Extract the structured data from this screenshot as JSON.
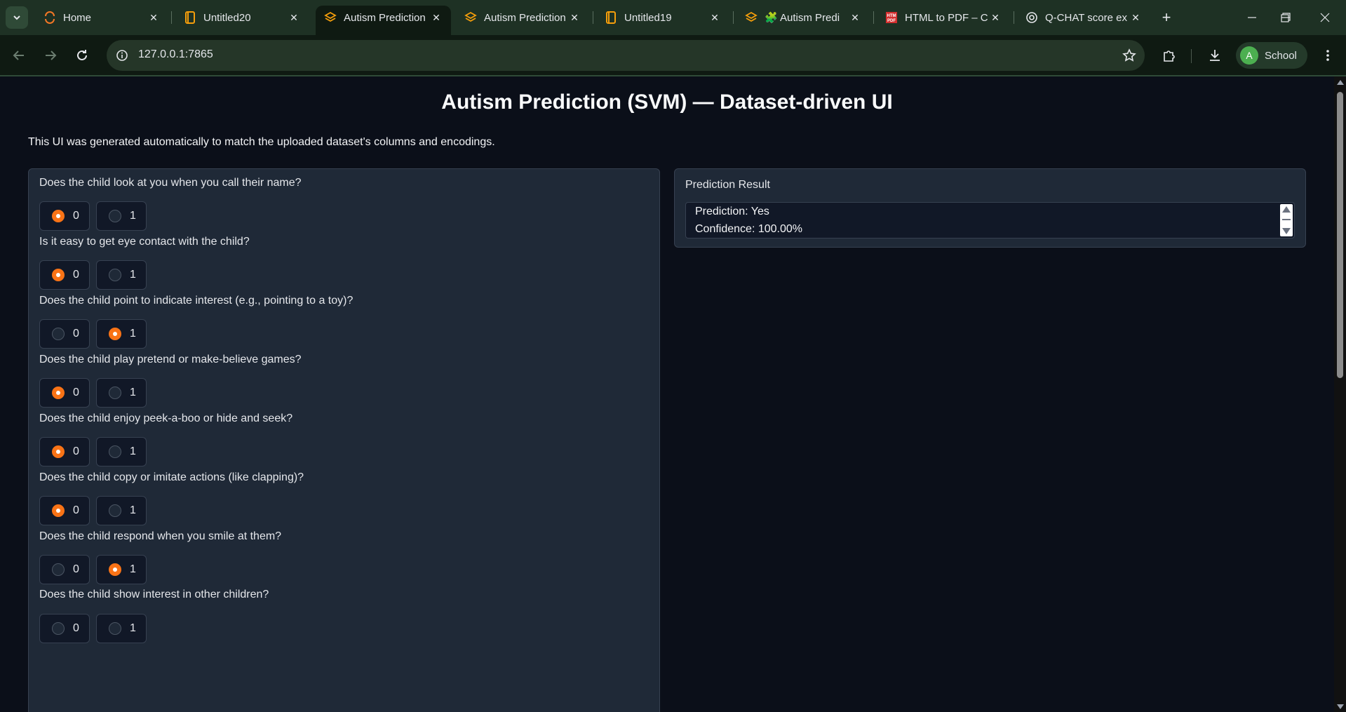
{
  "browser": {
    "tabs": [
      {
        "title": "Home",
        "icon": "jupyter-icon",
        "active": false
      },
      {
        "title": "Untitled20",
        "icon": "notebook-icon",
        "active": false
      },
      {
        "title": "Autism Prediction",
        "icon": "gradio-icon",
        "active": true
      },
      {
        "title": "Autism Prediction",
        "icon": "gradio-icon",
        "active": false
      },
      {
        "title": "Untitled19",
        "icon": "notebook-icon",
        "active": false
      },
      {
        "title": "🧩 Autism Predi",
        "icon": "gradio-icon",
        "active": false
      },
      {
        "title": "HTML to PDF – C",
        "icon": "pdf-icon",
        "active": false
      },
      {
        "title": "Q-CHAT score ex",
        "icon": "chatgpt-icon",
        "active": false
      }
    ],
    "url": "127.0.0.1:7865",
    "profile": {
      "initial": "A",
      "name": "School"
    }
  },
  "page": {
    "title": "Autism Prediction (SVM) — Dataset-driven UI",
    "description": "This UI was generated automatically to match the uploaded dataset's columns and encodings."
  },
  "questions": [
    {
      "label": "Does the child look at you when you call their name?",
      "options": [
        "0",
        "1"
      ],
      "selected": "0"
    },
    {
      "label": "Is it easy to get eye contact with the child?",
      "options": [
        "0",
        "1"
      ],
      "selected": "0"
    },
    {
      "label": "Does the child point to indicate interest (e.g., pointing to a toy)?",
      "options": [
        "0",
        "1"
      ],
      "selected": "1"
    },
    {
      "label": "Does the child play pretend or make-believe games?",
      "options": [
        "0",
        "1"
      ],
      "selected": "0"
    },
    {
      "label": "Does the child enjoy peek-a-boo or hide and seek?",
      "options": [
        "0",
        "1"
      ],
      "selected": "0"
    },
    {
      "label": "Does the child copy or imitate actions (like clapping)?",
      "options": [
        "0",
        "1"
      ],
      "selected": "0"
    },
    {
      "label": "Does the child respond when you smile at them?",
      "options": [
        "0",
        "1"
      ],
      "selected": "1"
    },
    {
      "label": "Does the child show interest in other children?",
      "options": [
        "0",
        "1"
      ],
      "selected": ""
    }
  ],
  "result": {
    "label": "Prediction Result",
    "prediction": "Prediction: Yes",
    "confidence": "Confidence: 100.00%"
  },
  "colors": {
    "accent": "#f97316",
    "page_bg": "#0b0f19",
    "panel_bg": "#1f2937",
    "chrome_bg": "#1e3124"
  }
}
